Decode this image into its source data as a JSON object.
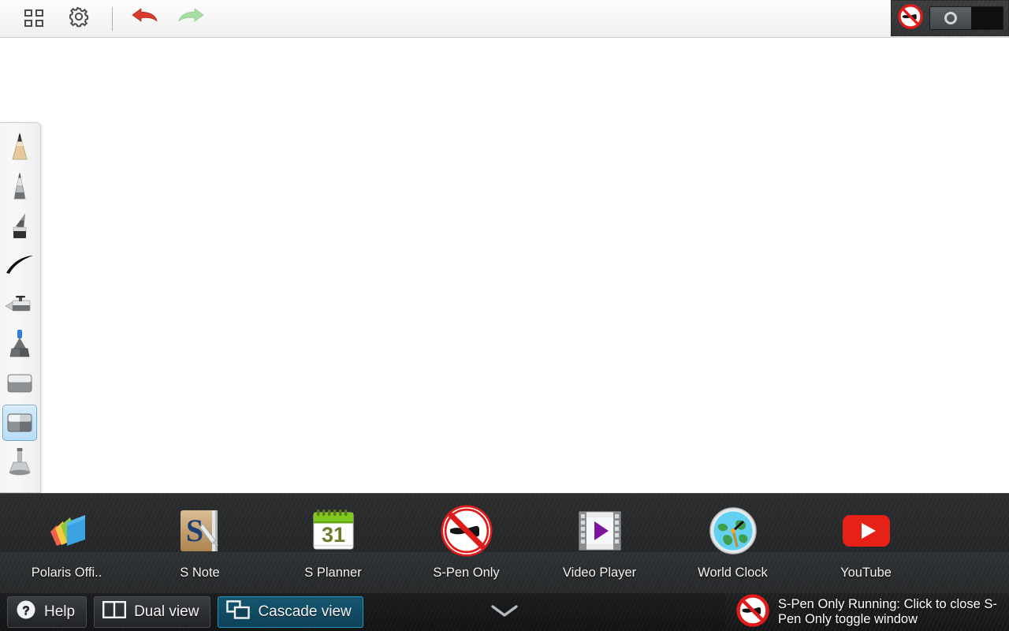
{
  "topbar": {
    "apps_button": "apps-grid",
    "settings_button": "settings",
    "undo_button": "undo",
    "redo_button": "redo",
    "more_button": "more-options",
    "pen_settings_button": "pen-settings"
  },
  "tools": {
    "items": [
      {
        "id": "pencil",
        "label": "Pencil",
        "selected": false
      },
      {
        "id": "pen",
        "label": "Pen",
        "selected": false
      },
      {
        "id": "brush",
        "label": "Brush",
        "selected": false
      },
      {
        "id": "calligraphy",
        "label": "Calligraphy",
        "selected": false
      },
      {
        "id": "marker",
        "label": "Marker",
        "selected": false
      },
      {
        "id": "highlighter",
        "label": "Highlighter",
        "selected": false
      },
      {
        "id": "eraser",
        "label": "Eraser",
        "selected": false
      },
      {
        "id": "eraser-all",
        "label": "Eraser (active)",
        "selected": true
      },
      {
        "id": "stamp",
        "label": "Stamp",
        "selected": false
      }
    ]
  },
  "canvas": {
    "content": ""
  },
  "dock": {
    "items": [
      {
        "id": "polaris-office",
        "label": "Polaris Offi.."
      },
      {
        "id": "s-note",
        "label": "S Note"
      },
      {
        "id": "s-planner",
        "label": "S Planner",
        "day": "31"
      },
      {
        "id": "s-pen-only",
        "label": "S-Pen Only"
      },
      {
        "id": "video-player",
        "label": "Video Player"
      },
      {
        "id": "world-clock",
        "label": "World Clock"
      },
      {
        "id": "youtube",
        "label": "YouTube"
      }
    ],
    "collapse_handle": "chevron-down"
  },
  "bottombar": {
    "help_label": "Help",
    "dual_view_label": "Dual view",
    "cascade_view_label": "Cascade view",
    "active_view": "Cascade view"
  },
  "toast": {
    "message": "S-Pen Only Running: Click to close S-Pen Only toggle window"
  },
  "spen_widget": {
    "state": "on",
    "icon": "no-hand-icon"
  },
  "colors": {
    "accent_blue": "#0d4259",
    "selection_blue": "#b9ddf6",
    "undo_red": "#d63b2e",
    "redo_green": "#a9dba4",
    "dock_dark": "#242628",
    "youtube_red": "#e62117"
  }
}
